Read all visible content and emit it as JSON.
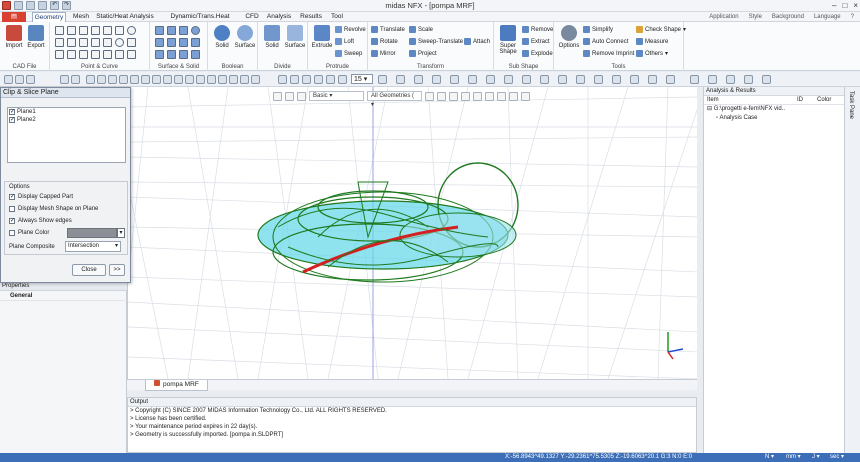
{
  "title": "midas NFX - [pompa MRF]",
  "tabs": [
    "Geometry",
    "Mesh",
    "Static/Heat Analysis",
    "Dynamic/Trans.Heat Analysis",
    "CFD",
    "Analysis",
    "Results",
    "Tool"
  ],
  "top_right": {
    "application": "Application",
    "style": "Style",
    "background": "Background",
    "language": "Language"
  },
  "ribbon": {
    "groups": [
      "CAD File",
      "Point & Curve",
      "Surface & Solid",
      "Boolean",
      "Divide",
      "Protrude",
      "Transform",
      "Sub Shape",
      "Tools"
    ],
    "cad": {
      "import": "Import",
      "export": "Export"
    },
    "boolean": {
      "solid": "Solid",
      "surface": "Surface"
    },
    "divide": {
      "solid": "Solid",
      "surface": "Surface"
    },
    "protrude": {
      "extrude": "Extrude",
      "revolve": "Revolve",
      "loft": "Loft",
      "sweep": "Sweep"
    },
    "transform": {
      "translate": "Translate",
      "rotate": "Rotate",
      "mirror": "Mirror",
      "scale": "Scale",
      "sweep_translate": "Sweep-Translate",
      "project": "Project",
      "attach": "Attach"
    },
    "subshape": {
      "super_shape": "Super Shape",
      "remove": "Remove",
      "extract": "Extract",
      "explode": "Explode"
    },
    "tools": {
      "options": "Options",
      "simplify": "Simplify",
      "auto_connect": "Auto Connect",
      "remove_imprint": "Remove Imprint",
      "check_shape": "Check Shape",
      "measure": "Measure",
      "others": "Others"
    }
  },
  "toolbar2": {
    "angle": "15"
  },
  "viewport": {
    "view_mode": "Basic",
    "filter": "All Geometries ("
  },
  "clip": {
    "title": "Clip & Slice Plane",
    "planes": [
      {
        "label": "Plane1",
        "checked": true
      },
      {
        "label": "Plane2",
        "checked": true
      }
    ],
    "options_title": "Options",
    "display_capped": "Display Capped Part",
    "display_capped_checked": true,
    "display_mesh": "Display Mesh Shape on Plane",
    "display_mesh_checked": false,
    "always_show": "Always Show edges",
    "always_show_checked": true,
    "plane_color": "Plane Color",
    "plane_color_checked": false,
    "plane_composite": "Plane Composite",
    "composite_value": "Intersection",
    "close": "Close",
    "more": ">>"
  },
  "properties": {
    "title": "Properties",
    "general": "General"
  },
  "analysis": {
    "title": "Analysis & Results",
    "col_item": "Item",
    "col_id": "ID",
    "col_color": "Color",
    "root": "G:\\progetti e-fem\\NFX vid..",
    "child": "Analysis Case"
  },
  "task_pane": "Task Pane",
  "model_tab": "pompa MRF",
  "output": {
    "title": "Output",
    "lines": [
      "> Copyright (C) SINCE 2007 MIDAS Information Technology Co., Ltd. ALL RIGHTS RESERVED.",
      "> License has been certified.",
      "> Your maintenance period expires in 22 day(s).",
      "> Geometry is successfully imported. [pompa in.SLDPRT]"
    ]
  },
  "status": {
    "coords": "X:-56.8943^49.1327 Y:-29.2361^75.5305 Z:-19.6063^20.1 G:3 N:0 E:0",
    "unit1": "N",
    "unit2": "mm",
    "unit3": "J",
    "unit4": "sec"
  },
  "colors": {
    "accent": "#1d3f78",
    "status_bg": "#3d6fb8",
    "model_green": "#1f7a1f",
    "cyan": "#5fd7e8",
    "red": "#d32020"
  }
}
